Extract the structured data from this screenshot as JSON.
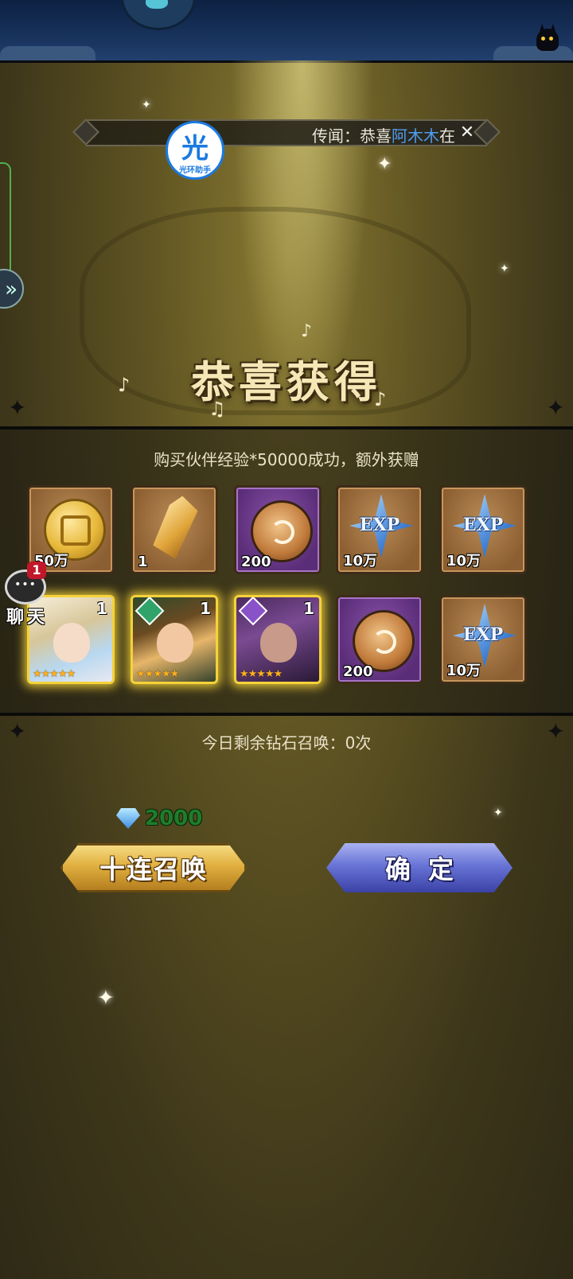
{
  "news_ticker": {
    "prefix": "传闻：恭喜",
    "player": "阿木木",
    "suffix": "在",
    "close_icon": "crossed-swords-close-icon"
  },
  "overlay_app": {
    "glyph": "光",
    "name": "光环助手"
  },
  "title": "恭喜获得",
  "subtitle": "购买伙伴经验*50000成功，额外获赠",
  "rewards": [
    {
      "type": "gold-coin",
      "qty": "50万"
    },
    {
      "type": "crystal",
      "qty": "1"
    },
    {
      "type": "purple-orb",
      "qty": "200"
    },
    {
      "type": "exp-star",
      "qty": "10万"
    },
    {
      "type": "exp-star",
      "qty": "10万"
    },
    {
      "type": "hero",
      "count": "1",
      "element": "none",
      "stars": "★★★★★"
    },
    {
      "type": "hero",
      "count": "1",
      "element": "nature",
      "stars": "★★★★★"
    },
    {
      "type": "hero",
      "count": "1",
      "element": "dark",
      "stars": "★★★★★"
    },
    {
      "type": "purple-orb",
      "qty": "200"
    },
    {
      "type": "exp-star",
      "qty": "10万"
    }
  ],
  "exp_label": "EXP",
  "chat": {
    "badge": "1",
    "label": "聊天"
  },
  "summon_remaining": "今日剩余钻石召唤：0次",
  "gems": "2000",
  "buttons": {
    "ten_summon": "十连召唤",
    "confirm": "确定"
  },
  "colors": {
    "gold_button": "#e1b040",
    "blue_button": "#6874d6",
    "player_name": "#4f9cf0",
    "gem_count": "#1e7d2a"
  }
}
